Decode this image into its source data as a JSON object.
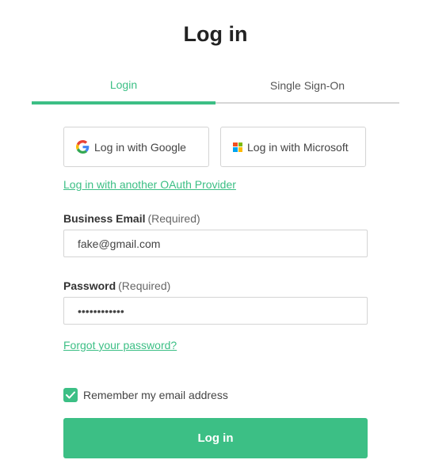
{
  "page": {
    "title": "Log in"
  },
  "tabs": [
    {
      "label": "Login",
      "active": true
    },
    {
      "label": "Single Sign-On",
      "active": false
    }
  ],
  "oauth": {
    "google_label": "Log in with Google",
    "microsoft_label": "Log in with Microsoft",
    "other_provider_link": "Log in with another OAuth Provider",
    "google_icon": "google-g-icon",
    "microsoft_icon": "microsoft-logo-icon"
  },
  "form": {
    "email": {
      "label": "Business Email",
      "required_text": "(Required)",
      "value": "fake@gmail.com"
    },
    "password": {
      "label": "Password",
      "required_text": "(Required)",
      "value": "••••••••••••"
    },
    "forgot_link": "Forgot your password?",
    "remember": {
      "label": "Remember my email address",
      "checked": true
    },
    "submit_label": "Log in"
  },
  "colors": {
    "accent": "#3cbf85",
    "border": "#d4d4d4"
  }
}
